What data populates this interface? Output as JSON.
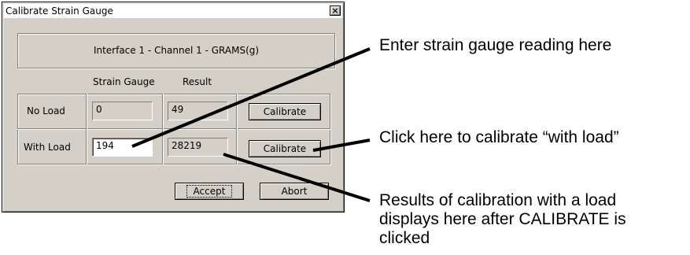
{
  "dialog": {
    "title": "Calibrate Strain Gauge",
    "close_glyph": "×",
    "header": "Interface 1 - Channel 1 - GRAMS(g)",
    "columns": {
      "strain_gauge": "Strain Gauge",
      "result": "Result"
    },
    "rows": [
      {
        "label": "No Load",
        "strain_gauge": "0",
        "result": "49",
        "button": "Calibrate"
      },
      {
        "label": "With Load",
        "strain_gauge": "194",
        "result": "28219",
        "button": "Calibrate"
      }
    ],
    "buttons": {
      "accept": "Accept",
      "abort": "Abort"
    }
  },
  "annotations": {
    "enter_reading": "Enter strain gauge reading here",
    "click_calibrate": "Click here to calibrate “with load”",
    "results_line1": "Results of calibration with a load",
    "results_line2": "displays here after CALIBRATE is",
    "results_line3": "clicked"
  }
}
